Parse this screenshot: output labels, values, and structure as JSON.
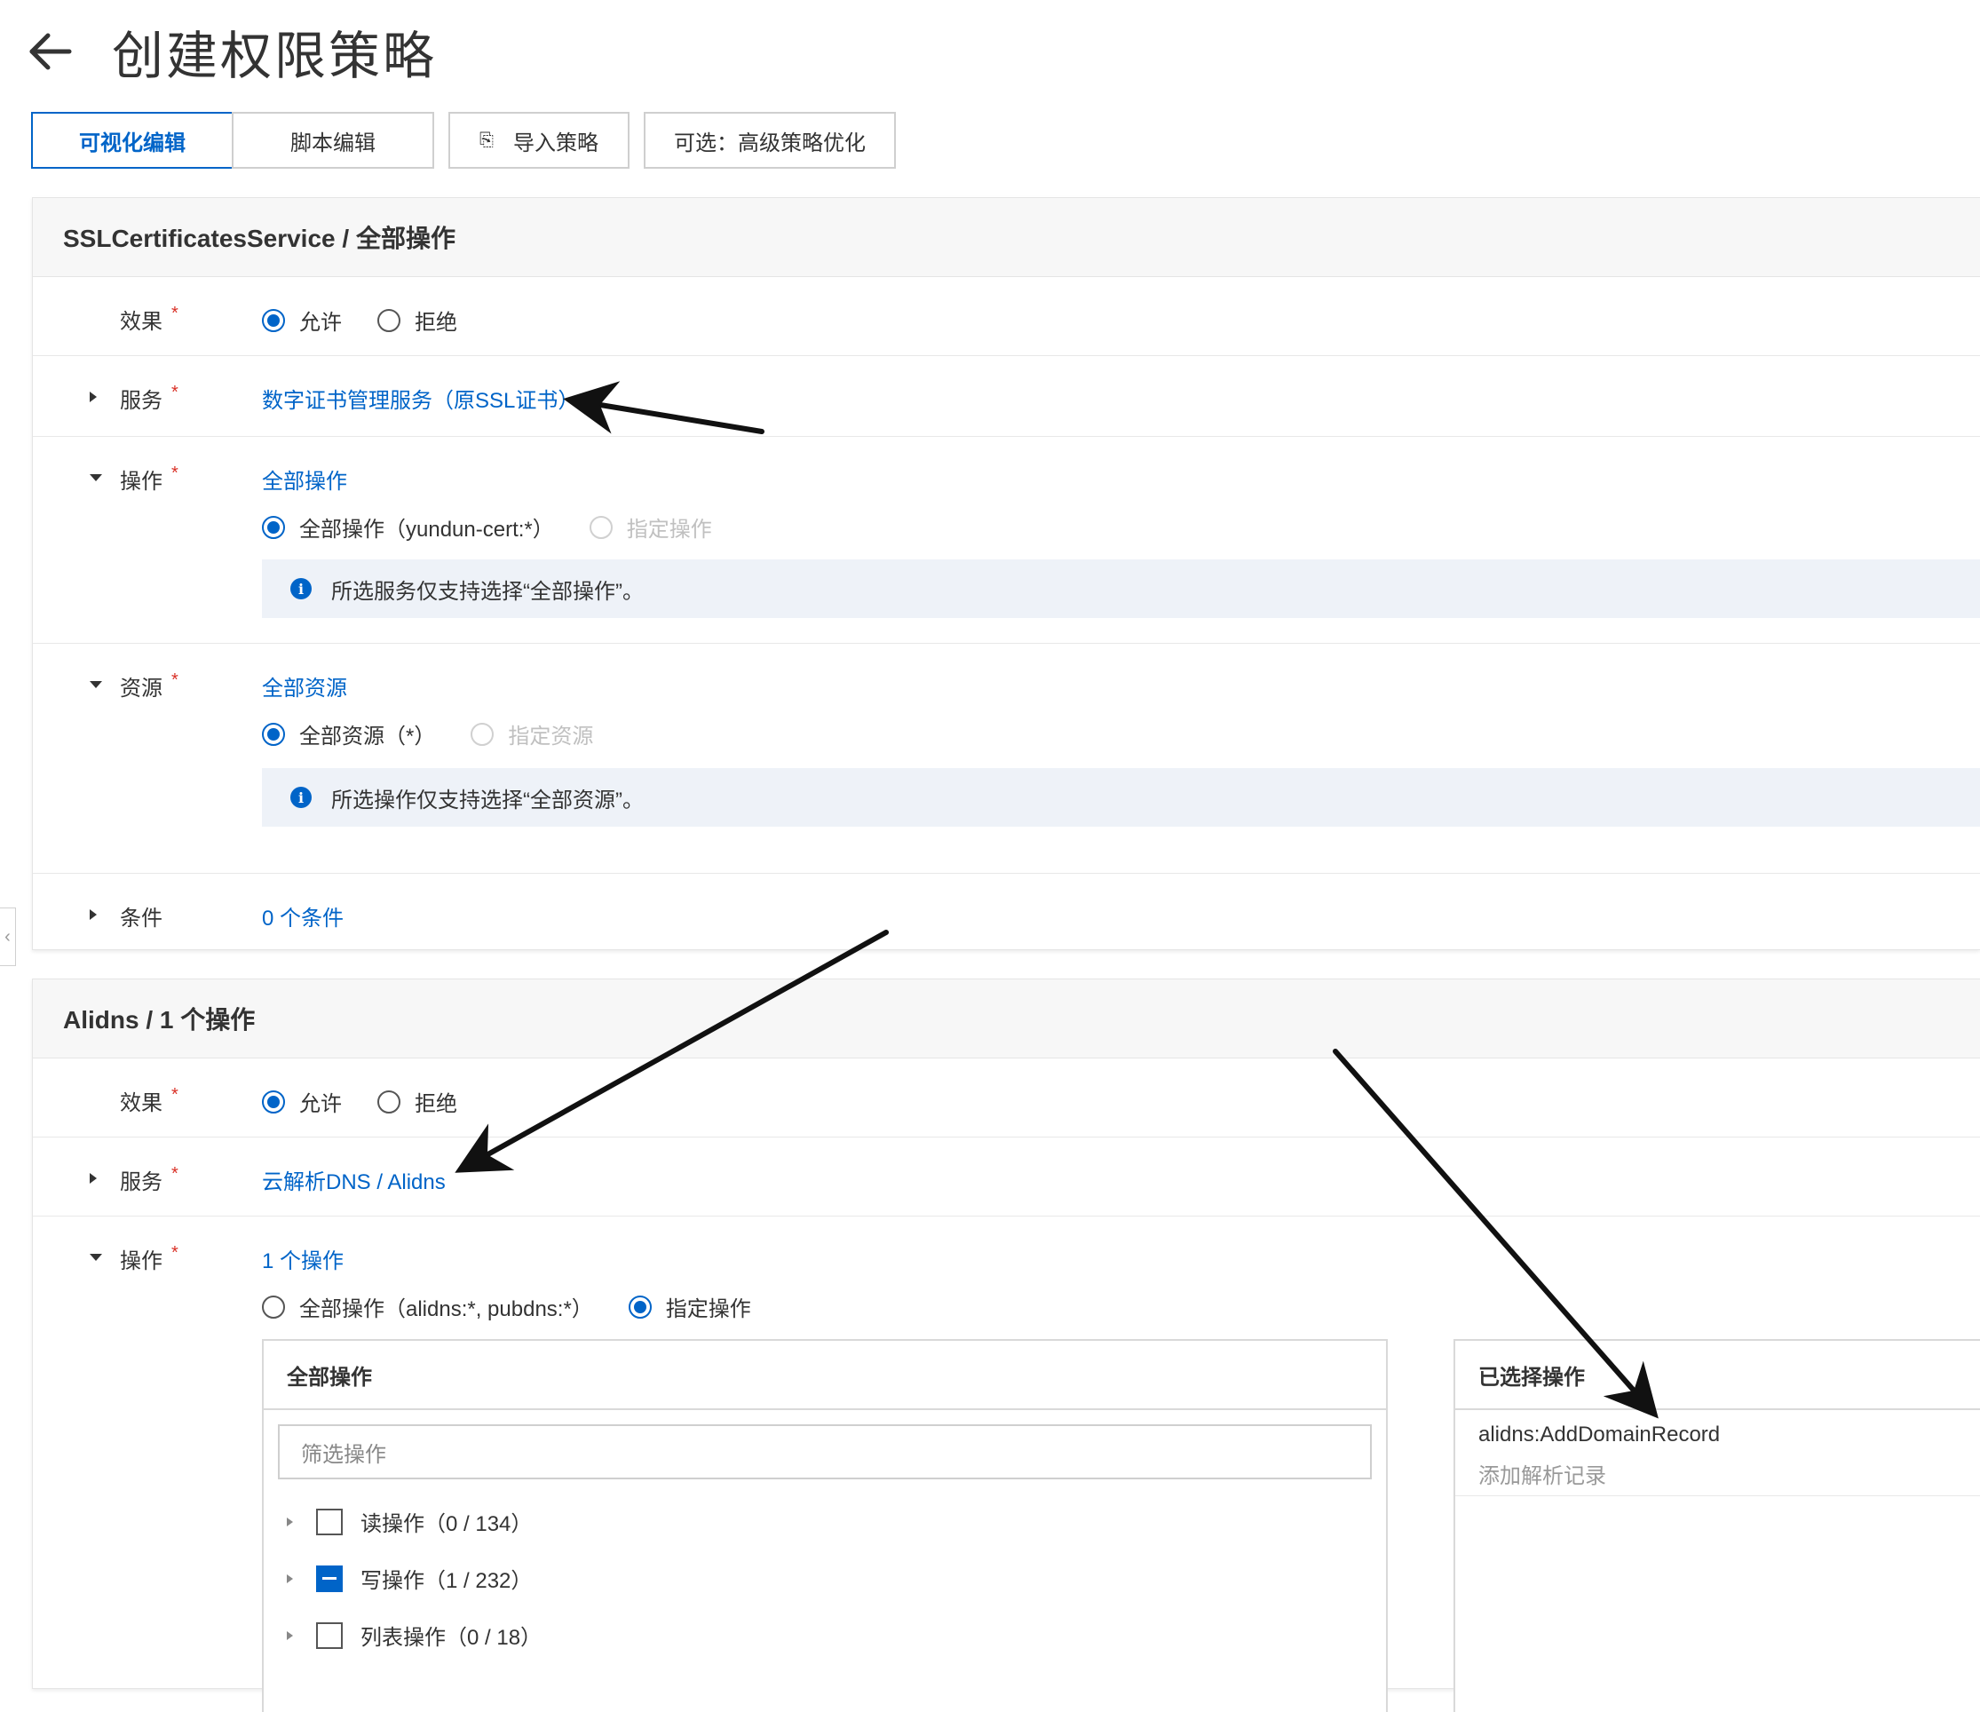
{
  "page": {
    "title": "创建权限策略"
  },
  "tabs": {
    "visual": "可视化编辑",
    "script": "脚本编辑",
    "import": "导入策略",
    "optimize": "可选：高级策略优化"
  },
  "section1": {
    "header": "SSLCertificatesService / 全部操作",
    "effect": {
      "label": "效果",
      "allow": "允许",
      "deny": "拒绝",
      "selected": "允许"
    },
    "service": {
      "label": "服务",
      "value": "数字证书管理服务（原SSL证书）"
    },
    "action": {
      "label": "操作",
      "summary": "全部操作",
      "opt_all": "全部操作（yundun-cert:*）",
      "opt_specific": "指定操作",
      "notice": "所选服务仅支持选择“全部操作”。"
    },
    "resource": {
      "label": "资源",
      "summary": "全部资源",
      "opt_all": "全部资源（*）",
      "opt_specific": "指定资源",
      "notice": "所选操作仅支持选择“全部资源”。"
    },
    "condition": {
      "label": "条件",
      "value": "0 个条件"
    }
  },
  "section2": {
    "header": "Alidns / 1 个操作",
    "effect": {
      "label": "效果",
      "allow": "允许",
      "deny": "拒绝",
      "selected": "允许"
    },
    "service": {
      "label": "服务",
      "value": "云解析DNS / Alidns"
    },
    "action": {
      "label": "操作",
      "summary": "1 个操作",
      "opt_all": "全部操作（alidns:*, pubdns:*）",
      "opt_specific": "指定操作"
    },
    "all_actions_panel": {
      "title": "全部操作",
      "filter_placeholder": "筛选操作",
      "groups": [
        {
          "label": "读操作（0 / 134）",
          "state": "unchecked"
        },
        {
          "label": "写操作（1 / 232）",
          "state": "partial"
        },
        {
          "label": "列表操作（0 / 18）",
          "state": "unchecked"
        }
      ]
    },
    "selected_panel": {
      "title": "已选择操作",
      "items": [
        {
          "code": "alidns:AddDomainRecord",
          "desc": "添加解析记录"
        }
      ]
    }
  },
  "icons": {
    "back": "arrow-left-icon",
    "import": "import-icon",
    "info": "info-icon",
    "collapse": "chevron-left-icon"
  },
  "colors": {
    "accent": "#0064c8",
    "required": "#d93026"
  }
}
